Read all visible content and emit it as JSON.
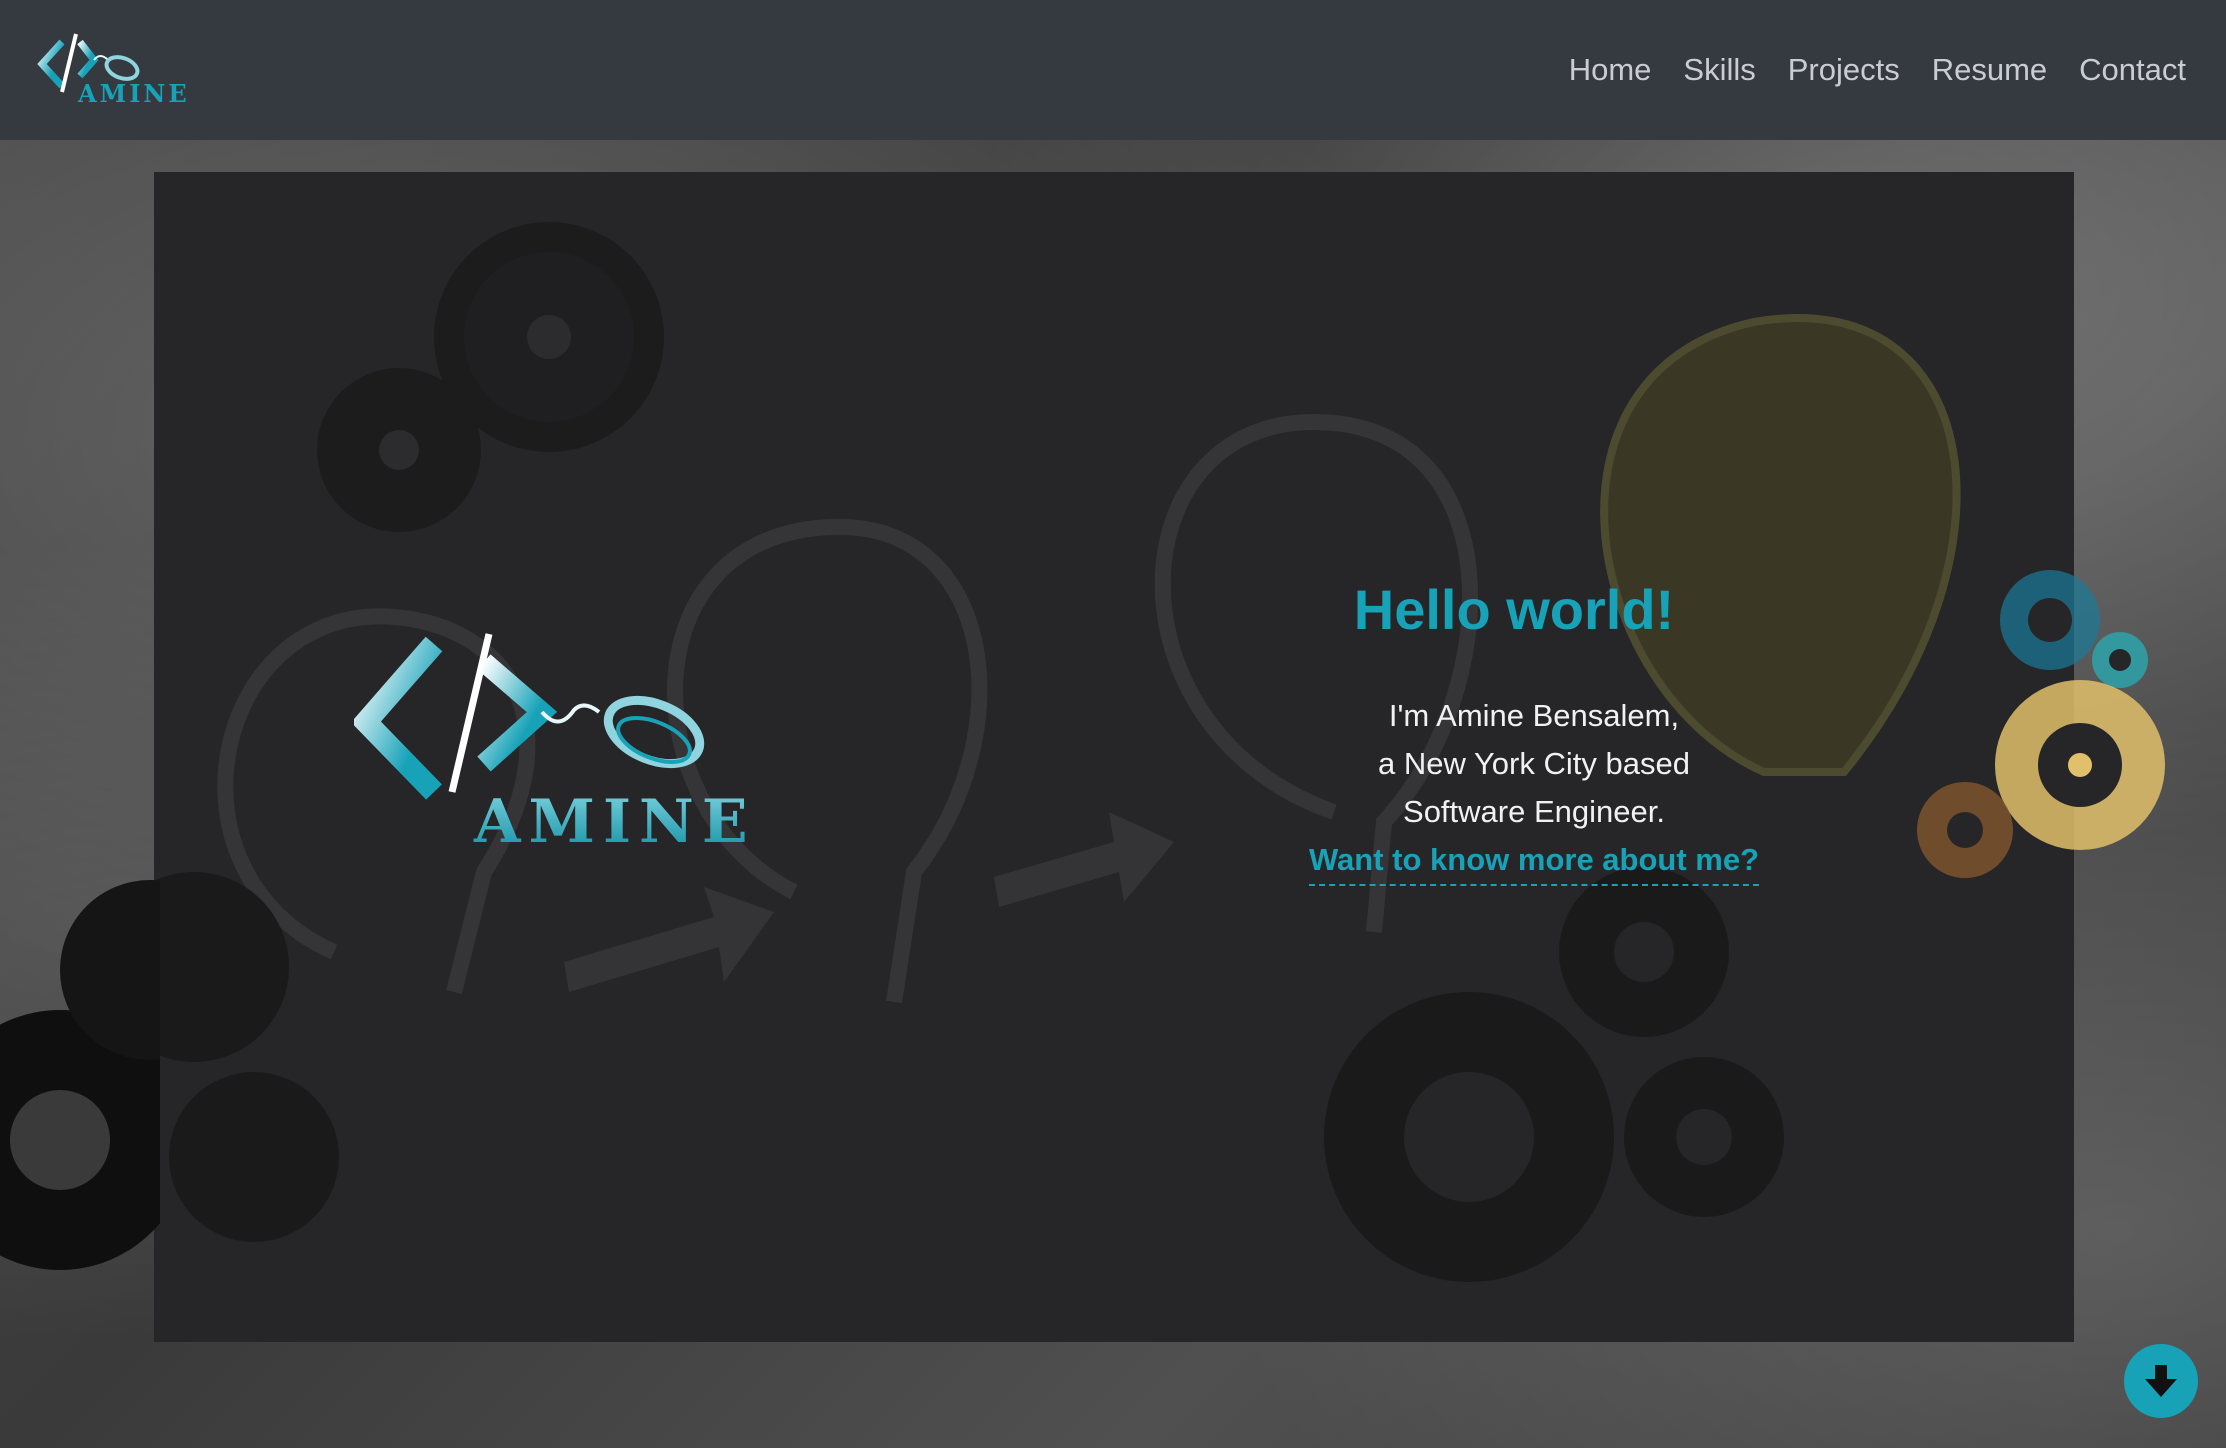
{
  "nav": {
    "brand_alt": "AMINE",
    "links": [
      "Home",
      "Skills",
      "Projects",
      "Resume",
      "Contact"
    ]
  },
  "hero": {
    "title": "Hello world!",
    "intro_line1": "I'm Amine Bensalem,",
    "intro_line2": "a New York City based",
    "intro_line3": "Software Engineer.",
    "cta_link": "Want to know more about me?",
    "logo_text": "AMINE"
  },
  "icons": {
    "scroll_down": "arrow-down-circle-icon"
  },
  "colors": {
    "accent": "#17a2b8",
    "navbar": "#343a40",
    "panel": "#262628",
    "nav_text": "#c9cdd1"
  }
}
